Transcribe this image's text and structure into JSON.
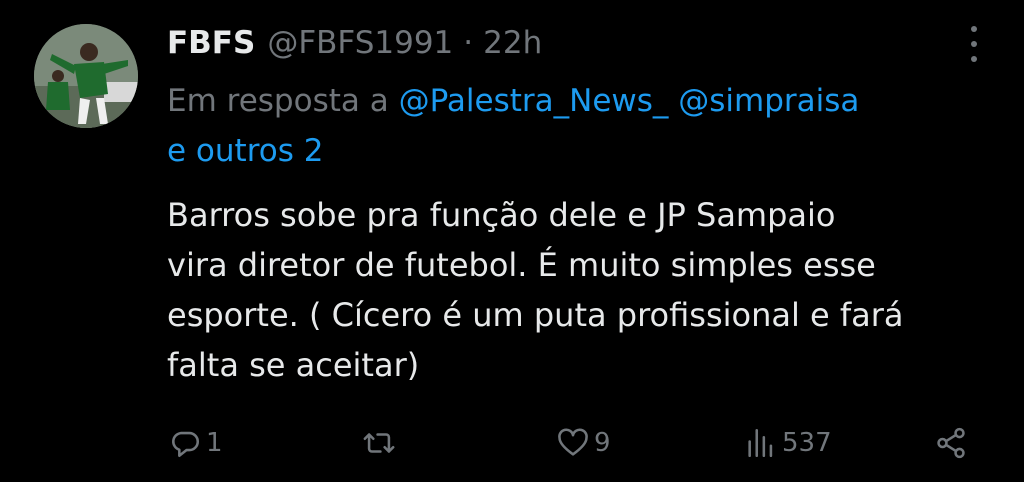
{
  "user": {
    "name": "FBFS",
    "handle": "@FBFS1991",
    "separator": "·",
    "time": "22h"
  },
  "reply": {
    "prefix": "Em resposta a",
    "mention1": "@Palestra_News_",
    "mention2": "@simpraisa",
    "suffix": "e outros 2"
  },
  "tweet": {
    "text": "Barros sobe pra função dele e JP Sampaio\nvira diretor de futebol. É muito simples esse\nesporte. ( Cícero é um puta profissional e fará\nfalta se aceitar)"
  },
  "actions": {
    "replies": "1",
    "retweets": "",
    "likes": "9",
    "views": "537"
  },
  "icons": {
    "reply": "reply-icon",
    "retweet": "retweet-icon",
    "like": "heart-icon",
    "views": "views-icon",
    "share": "share-icon",
    "more": "more-icon"
  }
}
